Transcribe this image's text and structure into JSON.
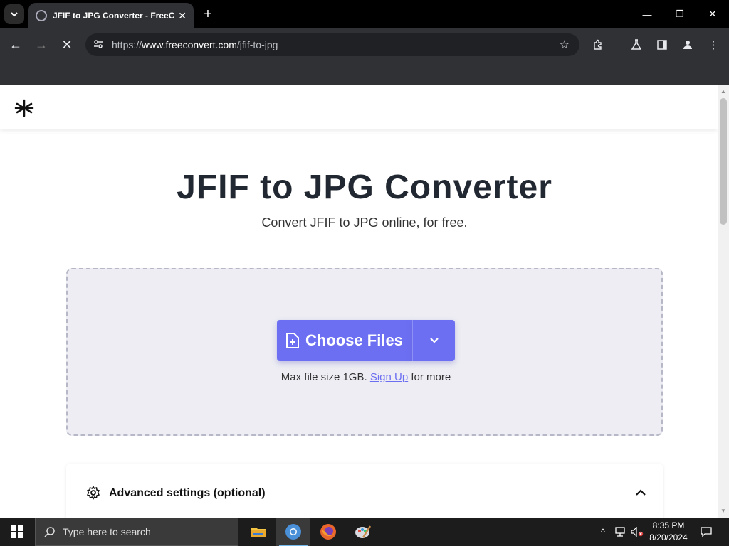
{
  "browser": {
    "tab_title": "JFIF to JPG Converter - FreeConvert",
    "url_prefix": "https://",
    "url_host": "www.freeconvert.com",
    "url_path": "/jfif-to-jpg"
  },
  "page": {
    "title": "JFIF to JPG Converter",
    "subtitle": "Convert JFIF to JPG online, for free.",
    "choose_files_label": "Choose Files",
    "max_size_text": "Max file size 1GB.",
    "signup_link": "Sign Up",
    "for_more_text": "for more",
    "advanced_label": "Advanced settings (optional)"
  },
  "taskbar": {
    "search_placeholder": "Type here to search",
    "time": "8:35 PM",
    "date": "8/20/2024"
  },
  "colors": {
    "accent": "#6c6ff2",
    "title": "#222831"
  }
}
